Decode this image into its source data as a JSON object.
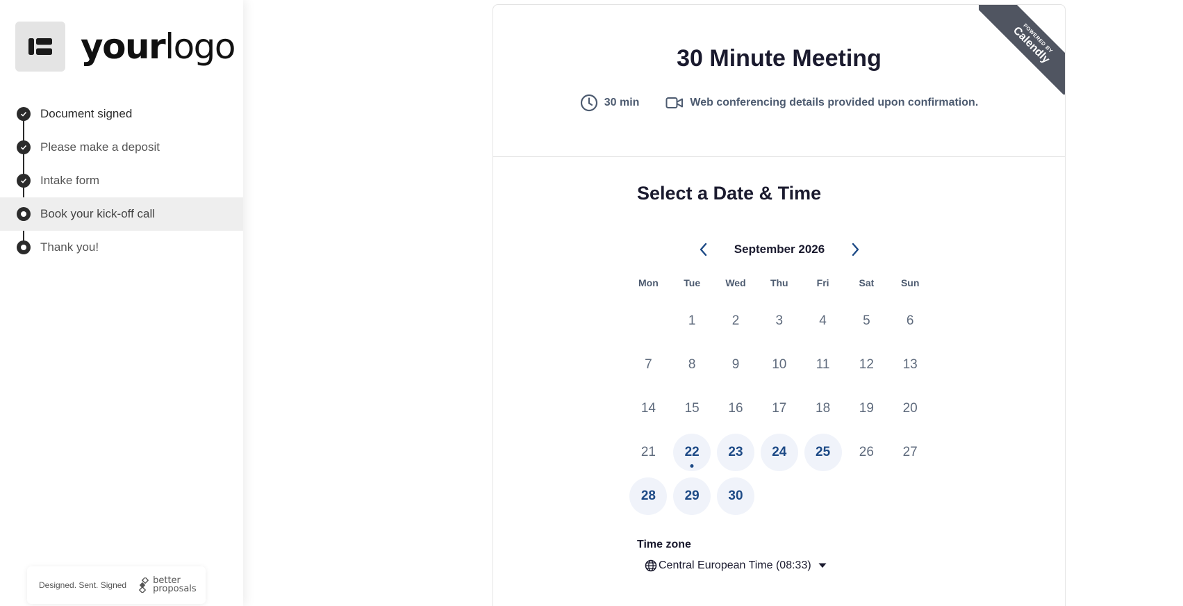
{
  "sidebar": {
    "logo": {
      "text_bold": "your",
      "text_light": "logo"
    },
    "steps": [
      {
        "label": "Document signed",
        "state": "done"
      },
      {
        "label": "Please make a deposit",
        "state": "done"
      },
      {
        "label": "Intake form",
        "state": "done"
      },
      {
        "label": "Book your kick-off call",
        "state": "current"
      },
      {
        "label": "Thank you!",
        "state": "upcoming"
      }
    ],
    "footer": {
      "tagline": "Designed. Sent. Signed",
      "brand_line1": "better",
      "brand_line2": "proposals"
    }
  },
  "event": {
    "ribbon_top": "POWERED BY",
    "ribbon_brand": "Calendly",
    "title": "30 Minute Meeting",
    "duration": "30 min",
    "location": "Web conferencing details provided upon confirmation."
  },
  "calendar": {
    "heading": "Select a Date & Time",
    "month": "September 2026",
    "weekdays": [
      "Mon",
      "Tue",
      "Wed",
      "Thu",
      "Fri",
      "Sat",
      "Sun"
    ],
    "weeks": [
      [
        "",
        "1",
        "2",
        "3",
        "4",
        "5",
        "6"
      ],
      [
        "7",
        "8",
        "9",
        "10",
        "11",
        "12",
        "13"
      ],
      [
        "14",
        "15",
        "16",
        "17",
        "18",
        "19",
        "20"
      ],
      [
        "21",
        "22",
        "23",
        "24",
        "25",
        "26",
        "27"
      ],
      [
        "28",
        "29",
        "30",
        "",
        "",
        "",
        ""
      ]
    ],
    "available_days": [
      "22",
      "23",
      "24",
      "25",
      "28",
      "29",
      "30"
    ],
    "today": "22"
  },
  "timezone": {
    "label": "Time zone",
    "value": "Central European Time (08:33)"
  },
  "colors": {
    "accent": "#1d4a86",
    "available_bg": "#f0f3fa",
    "ribbon": "#505561"
  }
}
